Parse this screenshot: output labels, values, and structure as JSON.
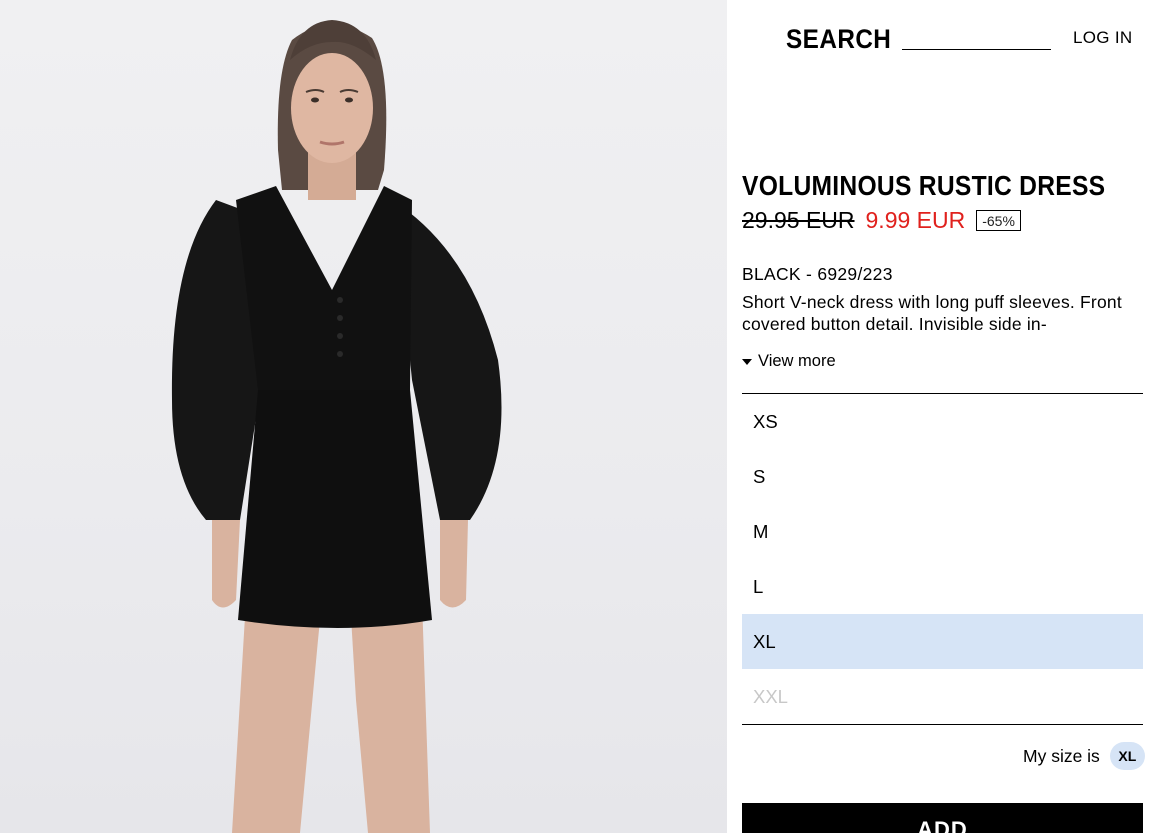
{
  "header": {
    "search_label": "SEARCH",
    "search_value": "",
    "login_label": "LOG IN"
  },
  "product": {
    "title": "VOLUMINOUS RUSTIC DRESS",
    "old_price": "29.95 EUR",
    "new_price": "9.99 EUR",
    "discount": "-65%",
    "color_ref": "BLACK - 6929/223",
    "description": "Short V-neck dress with long puff sleeves. Front covered button detail. Invisible side in-",
    "view_more_label": "View more",
    "sizes": [
      {
        "label": "XS",
        "state": "available"
      },
      {
        "label": "S",
        "state": "available"
      },
      {
        "label": "M",
        "state": "available"
      },
      {
        "label": "L",
        "state": "available"
      },
      {
        "label": "XL",
        "state": "selected"
      },
      {
        "label": "XXL",
        "state": "unavailable"
      }
    ],
    "my_size_label": "My size is",
    "my_size_value": "XL",
    "add_label": "ADD"
  },
  "colors": {
    "sale_price": "#e0211d",
    "selected_size_bg": "#d6e4f6",
    "unavailable_size": "#c8c8c8"
  }
}
